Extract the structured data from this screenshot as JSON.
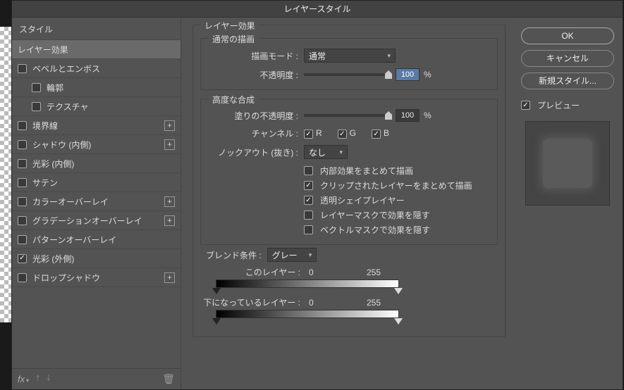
{
  "dialog_title": "レイヤースタイル",
  "styles_header": "スタイル",
  "styles": [
    {
      "label": "レイヤー効果",
      "checked": null,
      "selected": true
    },
    {
      "label": "ベベルとエンボス",
      "checked": false
    },
    {
      "label": "輪郭",
      "checked": false,
      "sub": true
    },
    {
      "label": "テクスチャ",
      "checked": false,
      "sub": true
    },
    {
      "label": "境界線",
      "checked": false,
      "add": true
    },
    {
      "label": "シャドウ (内側)",
      "checked": false,
      "add": true
    },
    {
      "label": "光彩 (内側)",
      "checked": false
    },
    {
      "label": "サテン",
      "checked": false
    },
    {
      "label": "カラーオーバーレイ",
      "checked": false,
      "add": true
    },
    {
      "label": "グラデーションオーバーレイ",
      "checked": false,
      "add": true
    },
    {
      "label": "パターンオーバーレイ",
      "checked": false
    },
    {
      "label": "光彩 (外側)",
      "checked": true
    },
    {
      "label": "ドロップシャドウ",
      "checked": false,
      "add": true
    }
  ],
  "fx_label": "fx",
  "effects": {
    "group_label": "レイヤー効果",
    "normal": {
      "legend": "通常の描画",
      "blend_mode_label": "描画モード :",
      "blend_mode_value": "通常",
      "opacity_label": "不透明度 :",
      "opacity_value": "100",
      "opacity_unit": "%"
    },
    "advanced": {
      "legend": "高度な合成",
      "fill_opacity_label": "塗りの不透明度 :",
      "fill_opacity_value": "100",
      "fill_opacity_unit": "%",
      "channels_label": "チャンネル :",
      "ch_r": "R",
      "ch_g": "G",
      "ch_b": "B",
      "knockout_label": "ノックアウト (抜き) :",
      "knockout_value": "なし",
      "opts": [
        {
          "label": "内部効果をまとめて描画",
          "checked": false
        },
        {
          "label": "クリップされたレイヤーをまとめて描画",
          "checked": true
        },
        {
          "label": "透明シェイプレイヤー",
          "checked": true
        },
        {
          "label": "レイヤーマスクで効果を隠す",
          "checked": false
        },
        {
          "label": "ベクトルマスクで効果を隠す",
          "checked": false
        }
      ]
    },
    "blendif": {
      "label": "ブレンド条件 :",
      "channel": "グレー",
      "this_layer_label": "このレイヤー :",
      "this_low": "0",
      "this_high": "255",
      "under_layer_label": "下になっているレイヤー :",
      "under_low": "0",
      "under_high": "255"
    }
  },
  "buttons": {
    "ok": "OK",
    "cancel": "キャンセル",
    "new_style": "新規スタイル...",
    "preview": "プレビュー"
  }
}
